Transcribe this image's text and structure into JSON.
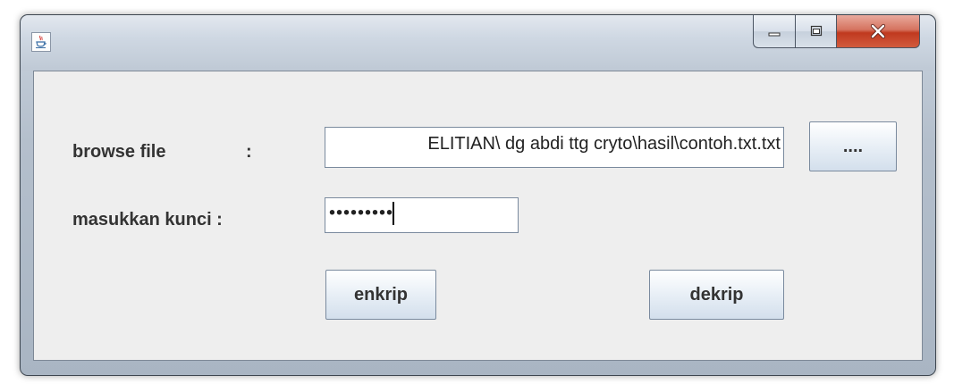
{
  "window": {
    "title": ""
  },
  "icons": {
    "app": "java-cup-icon",
    "minimize": "minimize-icon",
    "maximize": "maximize-icon",
    "close": "close-icon"
  },
  "colors": {
    "close_button": "#c0391f",
    "client_background": "#eeeeee"
  },
  "form": {
    "browse_label": "browse file",
    "browse_colon": ":",
    "file_path_value": "ELITIAN\\ dg abdi ttg cryto\\hasil\\contoh.txt.txt",
    "browse_button_label": "....",
    "key_label": "masukkan kunci :",
    "key_value": "•••••••••"
  },
  "actions": {
    "encrypt_label": "enkrip",
    "decrypt_label": "dekrip"
  }
}
